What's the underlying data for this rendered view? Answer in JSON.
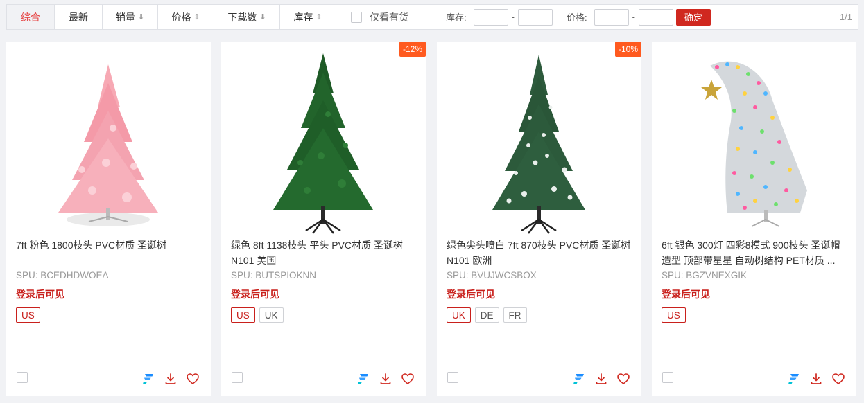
{
  "toolbar": {
    "sort_items": [
      {
        "label": "综合",
        "arrow": ""
      },
      {
        "label": "最新",
        "arrow": ""
      },
      {
        "label": "销量",
        "arrow": "⬇"
      },
      {
        "label": "价格",
        "arrow": "⇕"
      },
      {
        "label": "下载数",
        "arrow": "⬇"
      },
      {
        "label": "库存",
        "arrow": "⇕"
      }
    ],
    "only_in_stock": "仅看有货",
    "stock_label": "库存:",
    "price_label": "价格:",
    "dash": "-",
    "confirm": "确定",
    "page_count": "1/1"
  },
  "colors": {
    "accent": "#d0281f",
    "badge": "#ff5a1f",
    "link_blue": "#1a8cff"
  },
  "products": [
    {
      "title": "7ft 粉色 1800枝头 PVC材质 圣诞树",
      "spu": "SPU:  BCEDHDWOEA",
      "login_tip": "登录后可见",
      "discount": "",
      "tags": [
        "US"
      ]
    },
    {
      "title": "绿色 8ft 1138枝头 平头 PVC材质 圣诞树 N101 美国",
      "spu": "SPU:  BUTSPIOKNN",
      "login_tip": "登录后可见",
      "discount": "-12%",
      "tags": [
        "US",
        "UK"
      ]
    },
    {
      "title": "绿色尖头喷白 7ft 870枝头 PVC材质 圣诞树 N101 欧洲",
      "spu": "SPU:  BVUJWCSBOX",
      "login_tip": "登录后可见",
      "discount": "-10%",
      "tags": [
        "UK",
        "DE",
        "FR"
      ]
    },
    {
      "title": "6ft 银色 300灯 四彩8模式 900枝头 圣诞帽造型 顶部带星星 自动树结构 PET材质 ...",
      "spu": "SPU:  BGZVNEXGIK",
      "login_tip": "登录后可见",
      "discount": "",
      "tags": [
        "US"
      ]
    }
  ]
}
